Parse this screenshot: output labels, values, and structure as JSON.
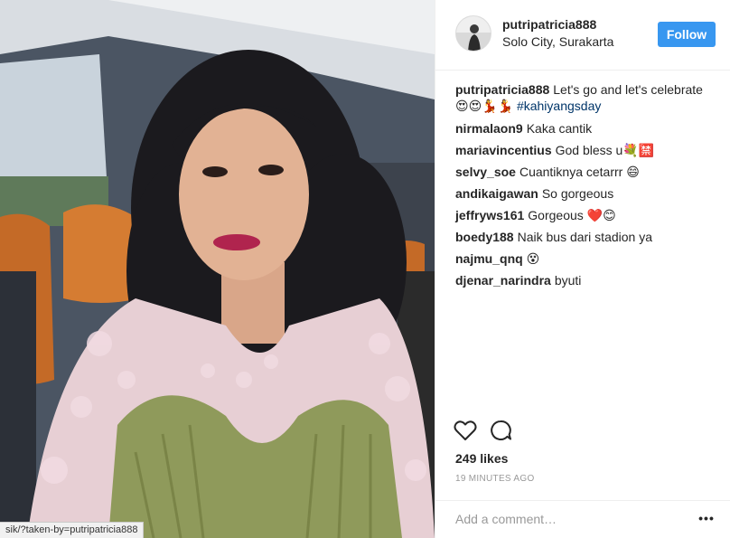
{
  "photo": {
    "status_url": "sik/?taken-by=putripatricia888"
  },
  "header": {
    "username": "putripatricia888",
    "location": "Solo City, Surakarta",
    "follow_label": "Follow"
  },
  "comments": [
    {
      "user": "putripatricia888",
      "text": "Let's go and let's celebrate",
      "emoji": "😍😍💃💃",
      "hashtag": "#kahiyangsday"
    },
    {
      "user": "nirmalaon9",
      "text": "Kaka cantik"
    },
    {
      "user": "mariavincentius",
      "text": "God bless u💐🈲"
    },
    {
      "user": "selvy_soe",
      "text": "Cuantiknya cetarrr 😄"
    },
    {
      "user": "andikaigawan",
      "text": "So gorgeous"
    },
    {
      "user": "jeffryws161",
      "text": "Gorgeous ❤️😊"
    },
    {
      "user": "boedy188",
      "text": "Naik bus dari stadion ya"
    },
    {
      "user": "najmu_qnq",
      "text": "😵"
    },
    {
      "user": "djenar_narindra",
      "text": "byuti"
    }
  ],
  "actions": {
    "like_icon": "heart-icon",
    "comment_icon": "comment-bubble-icon"
  },
  "likes_text": "249 likes",
  "time_text": "19 MINUTES AGO",
  "add_comment": {
    "placeholder": "Add a comment…",
    "more_label": "•••"
  },
  "colors": {
    "follow_button": "#3897f0",
    "hashtag": "#003569",
    "heart_red": "#e0245e"
  }
}
